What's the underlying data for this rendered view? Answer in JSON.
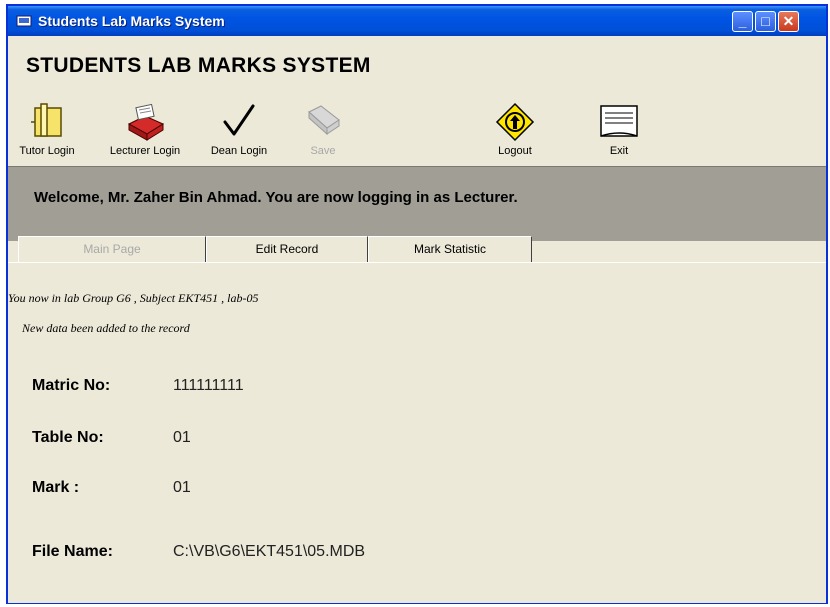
{
  "window": {
    "title": "Students Lab Marks System",
    "buttons": {
      "minimize": "_",
      "maximize": "□",
      "close": "✕"
    }
  },
  "app": {
    "heading": "STUDENTS LAB MARKS SYSTEM"
  },
  "toolbar": {
    "tutor_login": "Tutor Login",
    "lecturer_login": "Lecturer Login",
    "dean_login": "Dean Login",
    "save": "Save",
    "logout": "Logout",
    "exit": "Exit"
  },
  "welcome": {
    "message": "Welcome, Mr. Zaher Bin Ahmad. You are now logging in as Lecturer."
  },
  "tabs": {
    "main_page": "Main Page",
    "edit_record": "Edit Record",
    "mark_statistic": "Mark Statistic"
  },
  "status": {
    "lab_info": "You now in lab Group G6 , Subject EKT451 , lab-05",
    "record_message": "New data been added to the record"
  },
  "record": {
    "matric_label": "Matric No:",
    "matric_value": "111111111",
    "table_label": "Table No:",
    "table_value": "01",
    "mark_label": "Mark :",
    "mark_value": "01",
    "file_label": "File Name:",
    "file_value": "C:\\VB\\G6\\EKT451\\05.MDB"
  },
  "colors": {
    "titlebar": "#0054e3",
    "window_bg": "#ece9d8",
    "welcome_bg": "#a09e95",
    "disabled_text": "#a8a8a8"
  }
}
